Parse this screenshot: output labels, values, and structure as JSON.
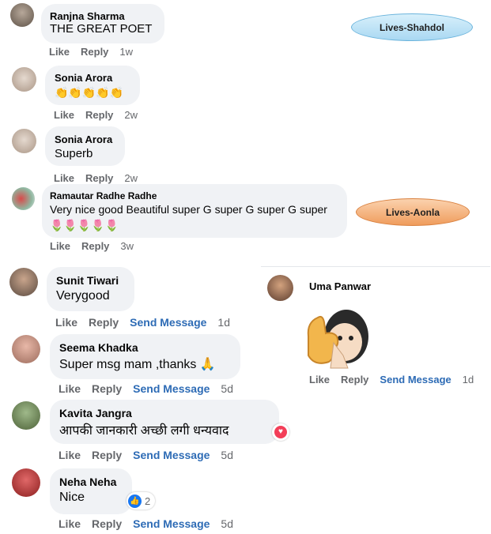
{
  "tags": {
    "shahdol": "Lives-Shahdol",
    "aonla": "Lives-Aonla"
  },
  "actions": {
    "like": "Like",
    "reply": "Reply",
    "send_message": "Send Message"
  },
  "comments": [
    {
      "name": "Ranjna Sharma",
      "text": "THE GREAT POET",
      "time": "1w"
    },
    {
      "name": "Sonia Arora",
      "text": "👏👏👏👏👏",
      "time": "2w"
    },
    {
      "name": "Sonia Arora",
      "text": "Superb",
      "time": "2w"
    },
    {
      "name": "Ramautar Radhe Radhe",
      "text": "Very nice good Beautiful super G super G super G super",
      "text2": "🌷🌷🌷🌷🌷",
      "time": "3w"
    },
    {
      "name": "Sunit Tiwari",
      "text": "Verygood",
      "time": "1d"
    },
    {
      "name": "Seema Khadka",
      "text": "Super msg mam ,thanks 🙏",
      "time": "5d"
    },
    {
      "name": "Kavita Jangra",
      "text": "आपकी जानकारी अच्छी लगी धन्यवाद",
      "time": "5d"
    },
    {
      "name": "Neha Neha",
      "text": "Nice",
      "time": "5d",
      "reaction_count": "2"
    }
  ],
  "sticker_comment": {
    "name": "Uma Panwar",
    "time": "1d"
  },
  "colors": {
    "bubble": "#f0f2f5",
    "send_message": "#2d6bb5",
    "tag_blue": "#bfe3f7",
    "tag_orange": "#f5b27c"
  }
}
